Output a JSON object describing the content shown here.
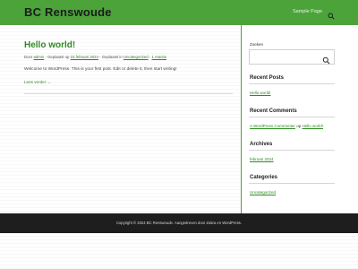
{
  "site": {
    "title": "BC Renswoude"
  },
  "nav": {
    "items": [
      {
        "label": "Sample Page"
      }
    ]
  },
  "post": {
    "title": "Hello world!",
    "meta": {
      "by_prefix": "Door",
      "author": "admin",
      "posted_on_prefix": "· Geplaatst op",
      "date": "23 februari 2024",
      "posted_in_prefix": "· Geplaatst in",
      "category": "Uncategorized",
      "comments_sep": "·",
      "comments": "1 reactie"
    },
    "excerpt": "Welcome to WordPress. This is your first post. Edit or delete it, then start writing!",
    "read_more": "Lees verder →"
  },
  "sidebar": {
    "search": {
      "label": "Zoeken",
      "value": ""
    },
    "recent_posts": {
      "title": "Recent Posts",
      "items": [
        "Hello world!"
      ]
    },
    "recent_comments": {
      "title": "Recent Comments",
      "author": "A WordPress Commenter",
      "connector": "op",
      "post": "Hello world!"
    },
    "archives": {
      "title": "Archives",
      "items": [
        "februari 2024"
      ]
    },
    "categories": {
      "title": "Categories",
      "items": [
        "Uncategorized"
      ]
    }
  },
  "footer": {
    "text": "Copyright © 2024 BC Renswoude. Aangedreven door Zakra en WordPress."
  },
  "colors": {
    "accent": "#4ba33a",
    "link": "#2f8a22",
    "footer_bg": "#1e1e1e"
  },
  "icons": {
    "header_search": "search-icon",
    "sidebar_search": "search-icon"
  }
}
